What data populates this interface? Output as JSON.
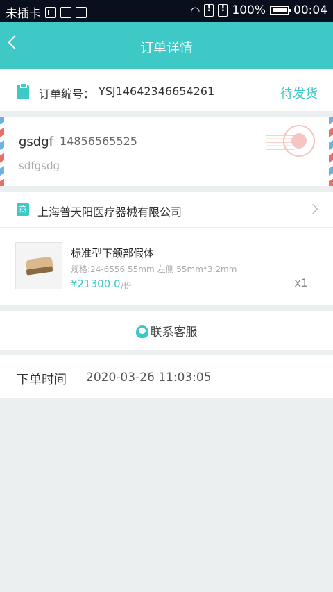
{
  "status_bar": {
    "carrier": "未插卡",
    "battery": "100%",
    "time": "00:04"
  },
  "header": {
    "title": "订单详情"
  },
  "order": {
    "label": "订单编号：",
    "number": "YSJ14642346654261",
    "status": "待发货"
  },
  "address": {
    "name": "gsdgf",
    "phone": "14856565525",
    "detail": "sdfgsdg"
  },
  "company": {
    "icon_text": "商",
    "name": "上海普天阳医疗器械有限公司"
  },
  "product": {
    "name": "标准型下颌部假体",
    "spec": "规格:24-6556 55mm 左侧 55mm*3.2mm",
    "price": "¥21300.0",
    "unit": "/份",
    "quantity": "x1"
  },
  "contact": {
    "label": "联系客服"
  },
  "order_time": {
    "label": "下单时间",
    "value": "2020-03-26 11:03:05"
  },
  "colors": {
    "accent": "#3ec9c6",
    "status_bar": "#0a0f1e",
    "background": "#eceff0"
  }
}
